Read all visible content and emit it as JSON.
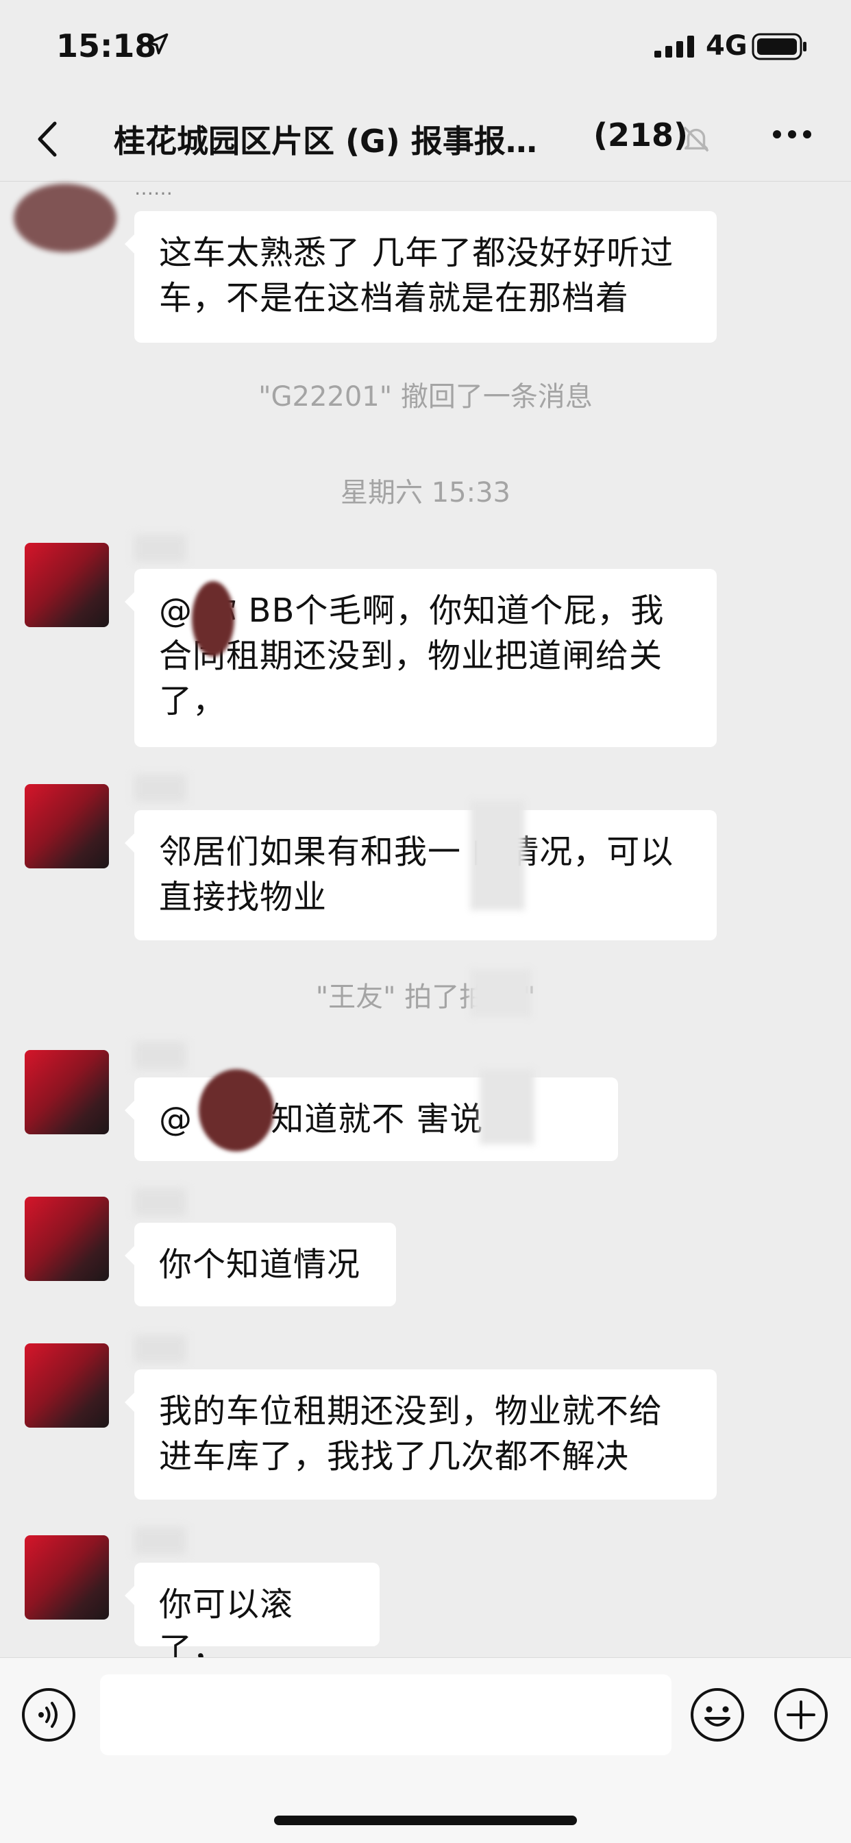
{
  "status_bar": {
    "time": "15:18",
    "network": "4G"
  },
  "nav": {
    "title": "桂花城园区片区 (G) 报事报…",
    "member_count": "(218)"
  },
  "messages": {
    "m1": {
      "sender": "……",
      "text": "这车太熟悉了 几年了都没好好听过车，不是在这档着就是在那档着"
    },
    "sys1": "\"G22201\" 撤回了一条消息",
    "time1": "星期六 15:33",
    "m2": {
      "text": "@    你 BB个毛啊，你知道个屁，我合同租期还没到，物业把道闸给关了，"
    },
    "m3": {
      "text": "邻居们如果有和我一   的情况，可以直接找物业"
    },
    "sys2": "\"王友\" 拍了拍      果\"",
    "m4": {
      "text": "@      你不知道就不   害说"
    },
    "m5": {
      "text": "你个知道情况"
    },
    "m6": {
      "text": "我的车位租期还没到，物业就不给进车库了，我找了几次都不解决"
    },
    "m7": {
      "text": "你可以滚了，"
    }
  },
  "icons": {
    "back": "chevron-left-icon",
    "mute": "bell-mute-icon",
    "more": "more-dots-icon",
    "voice": "voice-icon",
    "emoji": "emoji-icon",
    "plus": "plus-icon"
  }
}
